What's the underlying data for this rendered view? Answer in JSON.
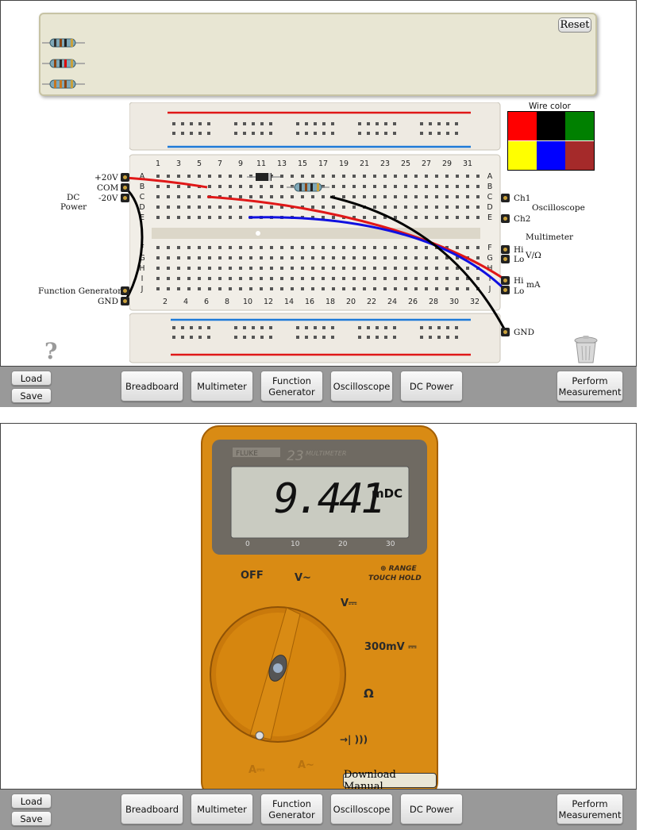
{
  "tray": {
    "reset_label": "Reset"
  },
  "breadboard": {
    "top_numbers": [
      "1",
      "3",
      "5",
      "7",
      "9",
      "11",
      "13",
      "15",
      "17",
      "19",
      "21",
      "23",
      "25",
      "27",
      "29",
      "31"
    ],
    "bottom_numbers": [
      "2",
      "4",
      "6",
      "8",
      "10",
      "12",
      "14",
      "16",
      "18",
      "20",
      "22",
      "24",
      "26",
      "28",
      "30",
      "32"
    ],
    "rows_top": [
      "A",
      "B",
      "C",
      "D",
      "E"
    ],
    "rows_bottom": [
      "F",
      "G",
      "H",
      "I",
      "J"
    ]
  },
  "dc_power": {
    "label_line1": "DC",
    "label_line2": "Power",
    "plus20": "+20V",
    "com": "COM",
    "minus20": "-20V"
  },
  "function_generator": {
    "label": "Function Generator",
    "gnd": "GND"
  },
  "oscilloscope": {
    "label": "Oscilloscope",
    "ch1": "Ch1",
    "ch2": "Ch2",
    "gnd": "GND"
  },
  "multimeter_jacks": {
    "label": "Multimeter",
    "hi1": "Hi",
    "lo1": "Lo",
    "vohm": "V/Ω",
    "hi2": "Hi",
    "lo2": "Lo",
    "ma": "mA"
  },
  "wire_color": {
    "title": "Wire color",
    "colors": [
      "#ff0000",
      "#000000",
      "#008000",
      "#ffff00",
      "#0000ff",
      "#a52a2a"
    ]
  },
  "toolbar": {
    "load": "Load",
    "save": "Save",
    "breadboard": "Breadboard",
    "multimeter": "Multimeter",
    "function_generator": "Function Generator",
    "oscilloscope": "Oscilloscope",
    "dc_power": "DC Power",
    "perform_measurement": "Perform Measurement"
  },
  "meter": {
    "brand": "FLUKE",
    "model": "23",
    "model_sub": "MULTIMETER",
    "reading": "9.441",
    "unit": "mDC",
    "scale": [
      "0",
      "10",
      "20",
      "30"
    ],
    "dial_labels": {
      "off": "OFF",
      "v_ac": "V~",
      "v_dc": "V⎓",
      "mv": "300mV ⎓",
      "ohm": "Ω",
      "diode": "→|  )))",
      "a_dc": "A⎓",
      "a_ac": "A~"
    },
    "range_line1": "⊕ RANGE",
    "range_line2": "TOUCH HOLD",
    "download_label": "Download Manual"
  }
}
